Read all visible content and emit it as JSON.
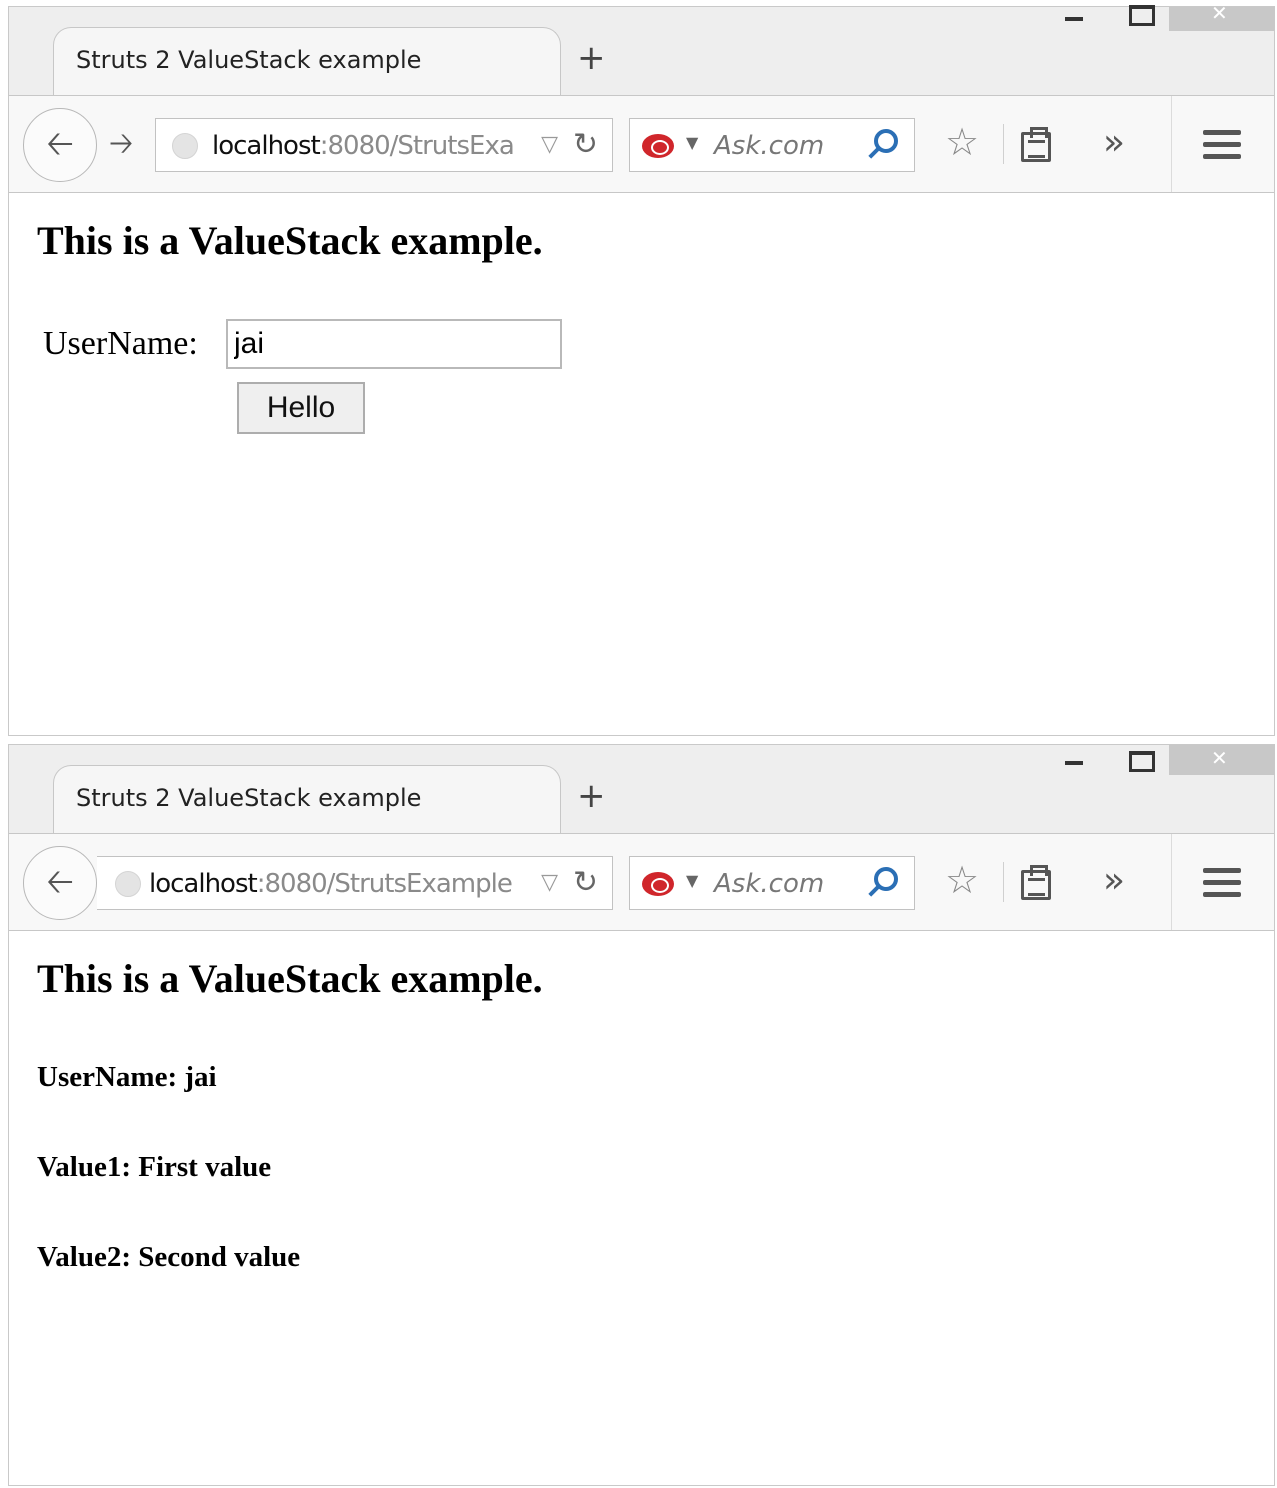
{
  "window1": {
    "tab_title": "Struts 2 ValueStack example",
    "url_host": "localhost",
    "url_path": ":8080/StrutsExa",
    "search_placeholder": "Ask.com",
    "heading": "This is a ValueStack example.",
    "form": {
      "username_label": "UserName:",
      "username_value": "jai",
      "submit_label": "Hello"
    }
  },
  "window2": {
    "tab_title": "Struts 2 ValueStack example",
    "url_host": "localhost",
    "url_path": ":8080/StrutsExample",
    "search_placeholder": "Ask.com",
    "heading": "This is a ValueStack example.",
    "results": [
      "UserName: jai",
      "Value1: First value",
      "Value2: Second value"
    ]
  },
  "toolbar": {
    "new_tab_glyph": "+",
    "overflow_glyph": "»"
  }
}
